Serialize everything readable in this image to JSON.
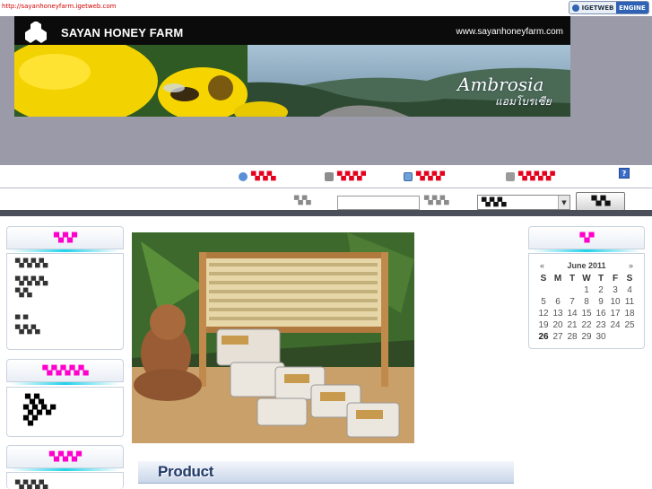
{
  "top_strip": {
    "url_text": "http://sayanhoneyfarm.igetweb.com",
    "badge_left": "IGETWEB",
    "badge_right": "ENGINE"
  },
  "banner": {
    "brand_name": "SAYAN HONEY FARM",
    "site_url": "www.sayanhoneyfarm.com",
    "product_brand": "Ambrosia",
    "product_brand_thai": "แอมโบรเซีย"
  },
  "nav": {
    "items": [
      {
        "icon": "home-icon",
        "label": "▀▄▀▄▀▄"
      },
      {
        "icon": "cart-icon",
        "label": "▀▄▀▄▀▄▀"
      },
      {
        "icon": "edit-icon",
        "label": "▀▄▀▄▀▄▀"
      },
      {
        "icon": "printer-icon",
        "label": "▀▄▀▄▀▄▀▄▀"
      }
    ],
    "help": "?"
  },
  "search": {
    "label": "▀▄▀▄",
    "input_value": "",
    "scope_label": "▀▄▀▄▀▄",
    "select_value": "▀▄▀▄▀▄",
    "button_label": "▀▄▀▄"
  },
  "sidebar_left": {
    "boxes": [
      {
        "title": "▀▄▀▄▀",
        "lines": [
          "▀▄▀▄▀▄▀▄",
          "▀▄▀▄▀▄▀▄",
          "▀▄▀▄",
          "▀  ▀",
          "▀▄▀▄▀▄"
        ]
      },
      {
        "title": "▀▄▀▄▀▄▀▄▀▄",
        "lines": [
          "▀▄▀▄",
          "▀▄▀▄▀▄▀",
          "▀▄▀"
        ]
      },
      {
        "title": "▀▄▀▄▀▄▀",
        "lines": [
          "▀▄▀▄▀▄▀▄"
        ]
      }
    ]
  },
  "main": {
    "product_heading": "Product"
  },
  "calendar": {
    "title": "▀▄▀",
    "prev": "«",
    "next": "»",
    "month": "June 2011",
    "weekdays": [
      "S",
      "M",
      "T",
      "W",
      "T",
      "F",
      "S"
    ],
    "weeks": [
      [
        "",
        "",
        "",
        "1",
        "2",
        "3",
        "4"
      ],
      [
        "5",
        "6",
        "7",
        "8",
        "9",
        "10",
        "11"
      ],
      [
        "12",
        "13",
        "14",
        "15",
        "16",
        "17",
        "18"
      ],
      [
        "19",
        "20",
        "21",
        "22",
        "23",
        "24",
        "25"
      ],
      [
        "26",
        "27",
        "28",
        "29",
        "30",
        "",
        ""
      ]
    ],
    "today": "26"
  },
  "colors": {
    "header_grey": "#9a9aa8",
    "accent_magenta": "#ff00cc",
    "nav_red": "#e4001c",
    "divider_dark": "#4b4f59",
    "product_heading_blue": "#233a6a"
  }
}
